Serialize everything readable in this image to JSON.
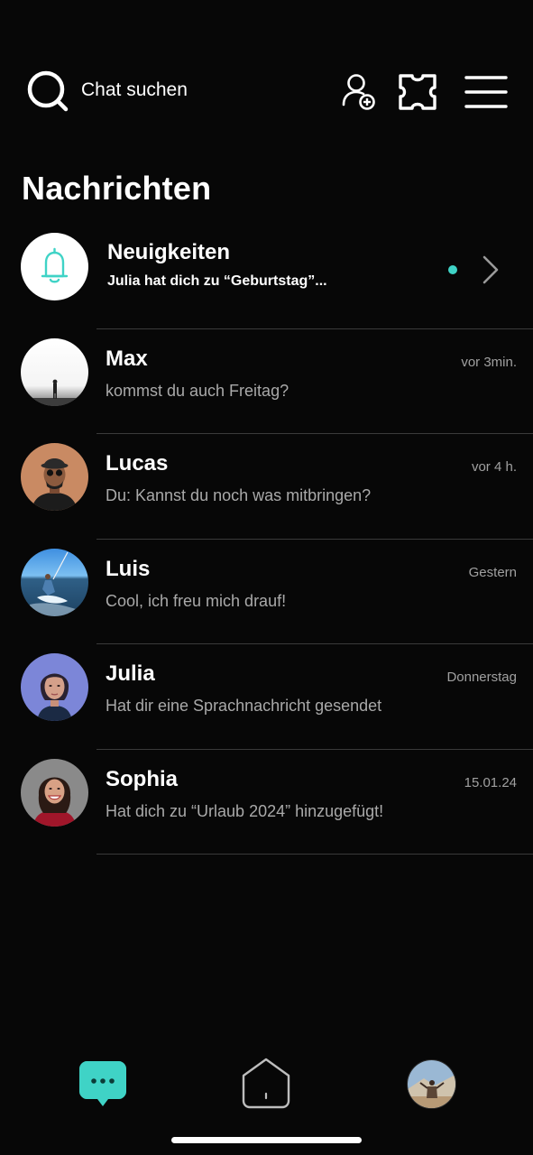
{
  "search": {
    "label": "Chat suchen",
    "icon": "search-icon"
  },
  "header_icons": {
    "add_user": "add-user-icon",
    "puzzle": "puzzle-icon",
    "menu": "hamburger-menu-icon"
  },
  "page_title": "Nachrichten",
  "news": {
    "title": "Neuigkeiten",
    "preview": "Julia hat dich zu “Geburtstag”...",
    "icon": "bell-icon",
    "unread": true,
    "accent_color": "#3fd3c6"
  },
  "chats": [
    {
      "name": "Max",
      "preview": "kommst du auch Freitag?",
      "time": "vor 3min."
    },
    {
      "name": "Lucas",
      "preview": "Du: Kannst du noch was mitbringen?",
      "time": "vor 4 h."
    },
    {
      "name": "Luis",
      "preview": "Cool, ich freu mich drauf!",
      "time": "Gestern"
    },
    {
      "name": "Julia",
      "preview": "Hat dir eine Sprachnachricht gesendet",
      "time": "Donnerstag"
    },
    {
      "name": "Sophia",
      "preview": "Hat dich zu “Urlaub 2024” hinzugefügt!",
      "time": "15.01.24"
    }
  ],
  "bottom_nav": {
    "chat": "chat-bubble-icon",
    "home": "home-icon",
    "profile": "profile-avatar"
  },
  "colors": {
    "background": "#070707",
    "accent": "#3fd3c6",
    "divider": "#3a3a3a",
    "secondary_text": "#a9a9a9"
  }
}
